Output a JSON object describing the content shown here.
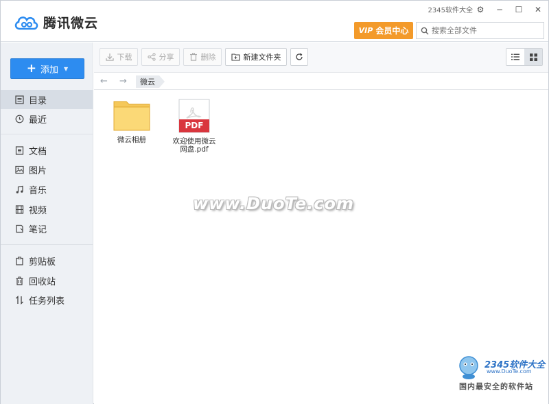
{
  "app": {
    "name": "腾讯微云",
    "brand_color": "#2d8cf0"
  },
  "topbar": {
    "software_link": "2345软件大全",
    "vip_label": "会员中心",
    "vip_prefix": "VIP",
    "search_placeholder": "搜索全部文件"
  },
  "sidebar": {
    "add_label": "添加",
    "groups": [
      [
        {
          "label": "目录",
          "icon": "list-icon",
          "active": true
        },
        {
          "label": "最近",
          "icon": "clock-icon",
          "active": false
        }
      ],
      [
        {
          "label": "文档",
          "icon": "document-icon"
        },
        {
          "label": "图片",
          "icon": "image-icon"
        },
        {
          "label": "音乐",
          "icon": "music-icon"
        },
        {
          "label": "视频",
          "icon": "video-icon"
        },
        {
          "label": "笔记",
          "icon": "note-icon"
        }
      ],
      [
        {
          "label": "剪贴板",
          "icon": "clipboard-icon"
        },
        {
          "label": "回收站",
          "icon": "trash-icon"
        },
        {
          "label": "任务列表",
          "icon": "transfer-icon"
        }
      ]
    ]
  },
  "toolbar": {
    "download": "下载",
    "share": "分享",
    "delete": "删除",
    "new_folder": "新建文件夹"
  },
  "breadcrumb": {
    "current": "微云"
  },
  "files": [
    {
      "name": "微云相册",
      "type": "folder"
    },
    {
      "name": "欢迎使用微云网盘.pdf",
      "type": "pdf",
      "badge": "PDF"
    }
  ],
  "watermark": {
    "text": "www.DuoTe.com",
    "corner_brand": "2345软件大全",
    "corner_url": "www.DuoTe.com",
    "corner_slogan": "国内最安全的软件站"
  }
}
